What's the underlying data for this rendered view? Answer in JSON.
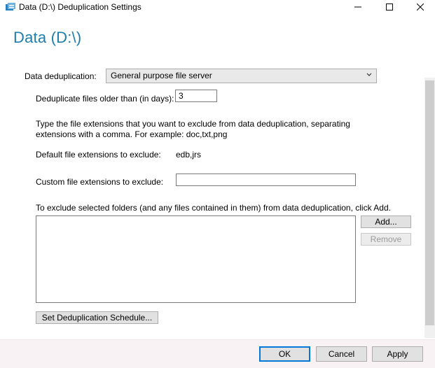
{
  "window": {
    "title": "Data (D:\\) Deduplication Settings"
  },
  "page": {
    "heading": "Data (D:\\)"
  },
  "settings": {
    "dedup_label": "Data deduplication:",
    "dedup_selected": "General purpose file server",
    "days_label": "Deduplicate files older than (in days):",
    "days_value": "3",
    "extensions_info": "Type the file extensions that you want to exclude from data deduplication, separating extensions with a comma. For example: doc,txt,png",
    "default_ext_label": "Default file extensions to exclude:",
    "default_ext_value": "edb,jrs",
    "custom_ext_label": "Custom file extensions to exclude:",
    "custom_ext_value": "",
    "exclude_folders_label": "To exclude selected folders (and any files contained in them) from data deduplication, click Add.",
    "add_label": "Add...",
    "remove_label": "Remove",
    "schedule_label": "Set Deduplication Schedule..."
  },
  "footer": {
    "ok_label": "OK",
    "cancel_label": "Cancel",
    "apply_label": "Apply"
  },
  "colors": {
    "heading": "#1f7dad",
    "default_button_border": "#0078d7",
    "footer_bg": "#f8f2f4"
  },
  "icons": [
    "dedup-app-icon",
    "minimize-icon",
    "maximize-icon",
    "close-icon",
    "chevron-down-icon"
  ]
}
